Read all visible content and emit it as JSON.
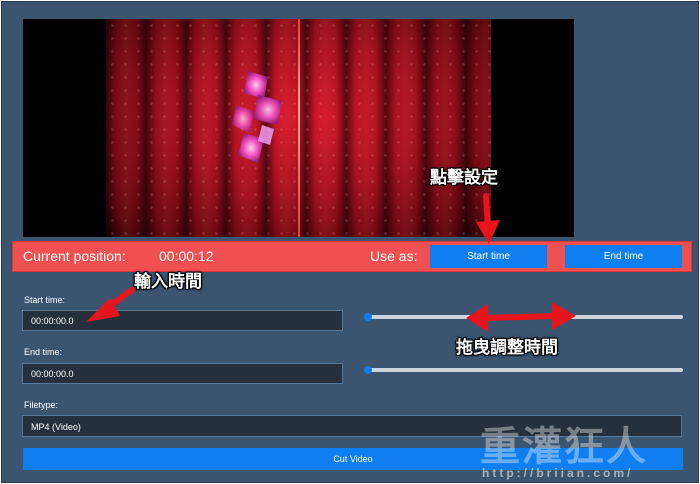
{
  "position_bar": {
    "label": "Current position:",
    "time": "00:00:12",
    "use_as_label": "Use as:",
    "start_time_button": "Start time",
    "end_time_button": "End time"
  },
  "start": {
    "label": "Start time:",
    "value": "00:00:00.0",
    "slider_fraction": 0.0
  },
  "end": {
    "label": "End time:",
    "value": "00:00:00.0",
    "slider_fraction": 0.0
  },
  "filetype": {
    "label": "Filetype:",
    "selected": "MP4 (Video)"
  },
  "cut_button": "Cut Video",
  "annotations": {
    "click_set": "點擊設定",
    "input_time": "輸入時間",
    "drag_adjust": "拖曳調整時間",
    "arrow_color": "#e8141b"
  },
  "watermark": {
    "logo_text": "重灌狂人",
    "url": "http://briian.com/"
  },
  "colors": {
    "panel_bg": "#3b5470",
    "position_bar_bg": "#f0504f",
    "accent_blue": "#0f7ef1",
    "field_bg": "#25303c"
  }
}
